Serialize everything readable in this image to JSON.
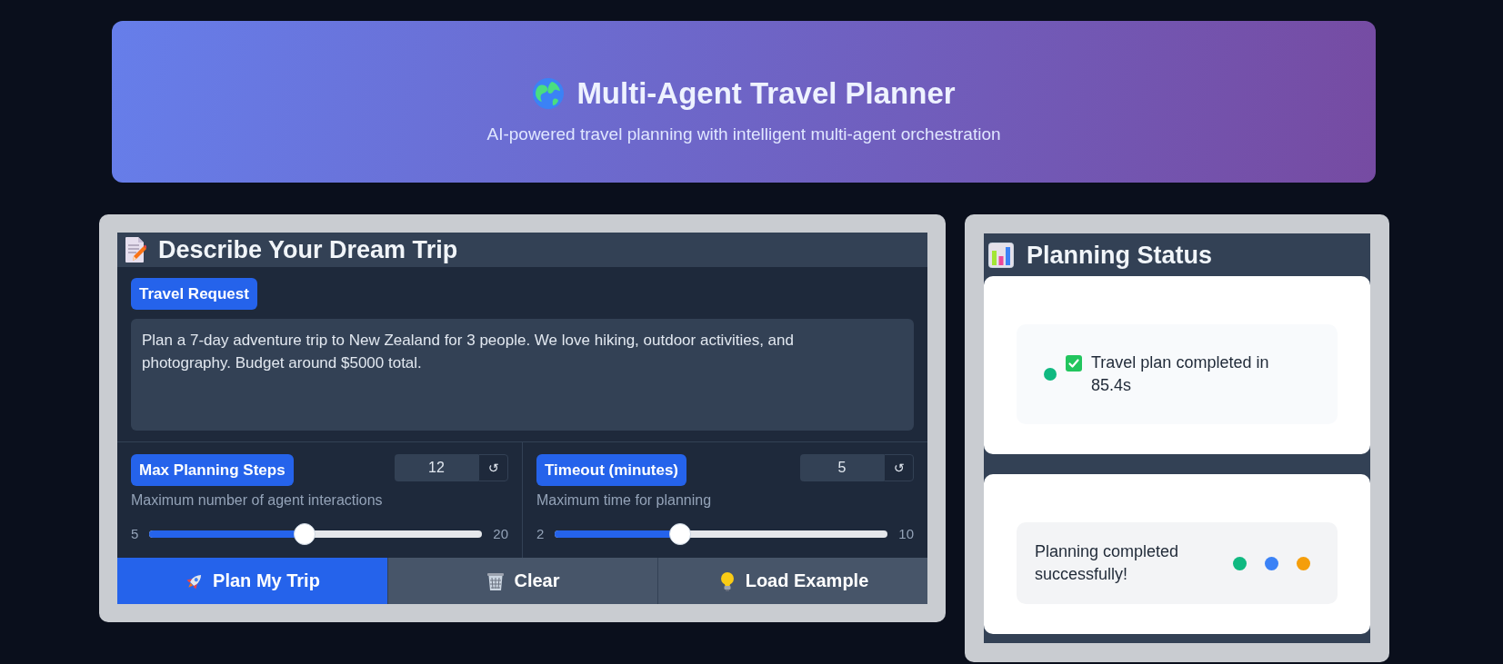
{
  "header": {
    "title": "Multi-Agent Travel Planner",
    "subtitle": "AI-powered travel planning with intelligent multi-agent orchestration"
  },
  "trip_form": {
    "title": "Describe Your Dream Trip",
    "request": {
      "label": "Travel Request",
      "value": "Plan a 7-day adventure trip to New Zealand for 3 people. We love hiking, outdoor activities, and photography. Budget around $5000 total."
    },
    "params": [
      {
        "label": "Max Planning Steps",
        "value": "12",
        "reset": "↺",
        "description": "Maximum number of agent interactions",
        "min": "5",
        "max": "20",
        "level": 0.467
      },
      {
        "label": "Timeout (minutes)",
        "value": "5",
        "reset": "↺",
        "description": "Maximum time for planning",
        "min": "2",
        "max": "10",
        "level": 0.375
      }
    ],
    "buttons": [
      {
        "label": "Plan My Trip",
        "kind": "primary"
      },
      {
        "label": "Clear",
        "kind": "secondary"
      },
      {
        "label": "Load Example",
        "kind": "secondary"
      }
    ]
  },
  "status": {
    "title": "Planning Status",
    "cards": [
      {
        "kind": "message",
        "color": "#10b981",
        "text": "Travel plan completed in 85.4s"
      },
      {
        "kind": "progress",
        "text": "Planning completed successfully!",
        "dots": [
          {
            "color": "#10b981"
          },
          {
            "color": "#3b82f6"
          },
          {
            "color": "#f59e0b"
          }
        ]
      }
    ]
  }
}
